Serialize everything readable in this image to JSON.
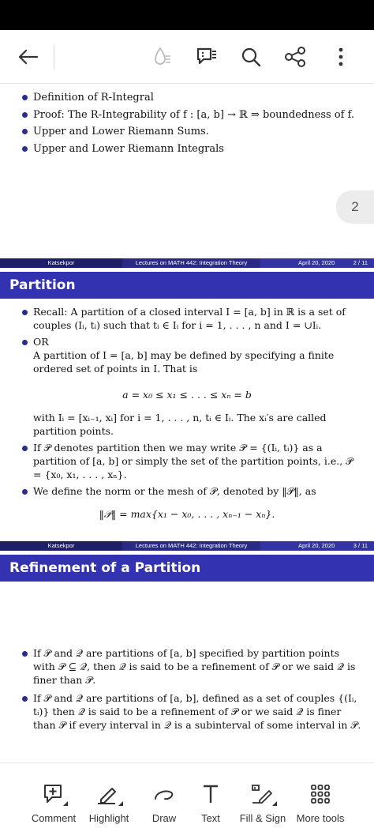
{
  "toolbar": {
    "icons": [
      "back-arrow-icon",
      "read-aloud-icon",
      "comments-icon",
      "search-icon",
      "share-icon",
      "more-options-icon"
    ]
  },
  "slide1": {
    "bullets": [
      "Definition of R-Integral",
      "Proof: The R-Integrability of f : [a, b] → ℝ ⇒ boundedness of f.",
      "Upper and Lower Riemann Sums.",
      "Upper and Lower Riemann Integrals"
    ],
    "page_badge": "2"
  },
  "footer1": {
    "author": "Katsekpor",
    "lecture": "Lectures on  MATH 442: Integration Theory",
    "date": "April 20, 2020",
    "page": "2 / 11"
  },
  "slide2": {
    "title": "Partition",
    "recall": "Recall: A partition of a closed interval I = [a, b] in ℝ is a set of couples (Iᵢ, tᵢ) such that tᵢ ∈ Iᵢ for i = 1, . . . , n and I = ∪Iᵢ.",
    "or": "OR",
    "or_text": "A partition of I = [a, b] may be defined by specifying a finite ordered set of points in I. That is",
    "eq1": "a = x₀ ≤ x₁ ≤ . . . ≤ xₙ = b",
    "with_text": "with Iᵢ = [xᵢ₋₁, xᵢ] for i = 1, . . . , n, tᵢ ∈ Iᵢ. The xᵢ′s are called partition points.",
    "if_text": "If 𝒫 denotes partition then we may write 𝒫 = {(Iᵢ, tᵢ)} as a partition of [a, b] or simply the set of the partition points, i.e., 𝒫 = {x₀, x₁, . . . , xₙ}.",
    "norm_text": "We define the norm or the mesh of 𝒫, denoted by ‖𝒫‖, as",
    "eq2": "‖𝒫‖ = max{x₁ − x₀, . . . , xₙ₋₁ − xₙ}."
  },
  "footer2": {
    "author": "Katsekpor",
    "lecture": "Lectures on  MATH 442: Integration Theory",
    "date": "April 20, 2020",
    "page": "3 / 11"
  },
  "slide3": {
    "title": "Refinement of a Partition",
    "bullets": [
      "If 𝒫 and 𝒬 are partitions of [a, b] specified by partition points with 𝒫 ⊆ 𝒬, then 𝒬 is said to be a refinement of 𝒫 or we said 𝒬 is finer than 𝒫.",
      "If 𝒫 and 𝒬 are partitions of [a, b], defined as a set of couples {(Iᵢ, tᵢ)} then 𝒬 is said to be a refinement of 𝒫 or we said 𝒬 is finer than 𝒫 if every interval in 𝒬 is a subinterval of some interval in 𝒫."
    ]
  },
  "bottom_tools": [
    {
      "label": "Comment",
      "icon": "comment-add-icon"
    },
    {
      "label": "Highlight",
      "icon": "highlight-pen-icon"
    },
    {
      "label": "Draw",
      "icon": "draw-squiggle-icon"
    },
    {
      "label": "Text",
      "icon": "text-tool-icon"
    },
    {
      "label": "Fill & Sign",
      "icon": "fill-sign-icon"
    },
    {
      "label": "More tools",
      "icon": "grid-more-icon"
    }
  ]
}
